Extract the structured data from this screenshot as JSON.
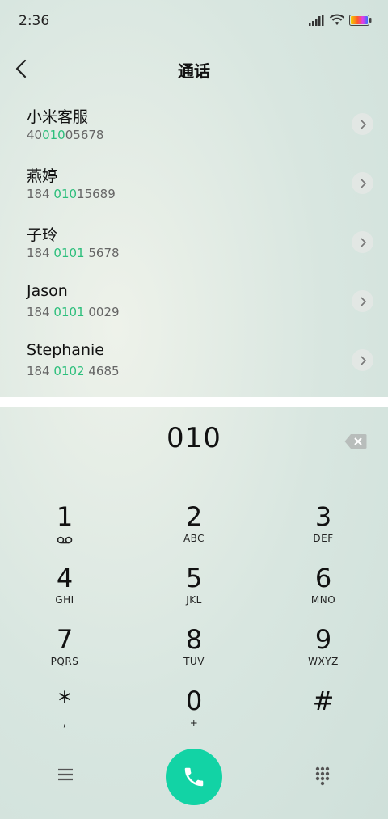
{
  "status_bar": {
    "time": "2:36",
    "icons": [
      "signal-icon",
      "wifi-icon",
      "battery-icon"
    ]
  },
  "header": {
    "title": "通话",
    "back_icon": "back-arrow-icon"
  },
  "contacts": [
    {
      "name": "小米客服",
      "number_pre": "40",
      "number_hl": "010",
      "number_post": "05678"
    },
    {
      "name": "燕婷",
      "number_pre": "184 ",
      "number_hl": "010",
      "number_post": "15689"
    },
    {
      "name": "子玲",
      "number_pre": "184 ",
      "number_hl": "0101",
      "number_post": " 5678"
    },
    {
      "name": "Jason",
      "number_pre": "184 ",
      "number_hl": "0101",
      "number_post": " 0029"
    },
    {
      "name": "Stephanie",
      "number_pre": "184 ",
      "number_hl": "0102",
      "number_post": " 4685"
    }
  ],
  "dialer": {
    "input_value": "010",
    "keys": [
      {
        "digit": "1",
        "letters": ""
      },
      {
        "digit": "2",
        "letters": "ABC"
      },
      {
        "digit": "3",
        "letters": "DEF"
      },
      {
        "digit": "4",
        "letters": "GHI"
      },
      {
        "digit": "5",
        "letters": "JKL"
      },
      {
        "digit": "6",
        "letters": "MNO"
      },
      {
        "digit": "7",
        "letters": "PQRS"
      },
      {
        "digit": "8",
        "letters": "TUV"
      },
      {
        "digit": "9",
        "letters": "WXYZ"
      },
      {
        "digit": "*",
        "letters": ","
      },
      {
        "digit": "0",
        "letters": "+"
      },
      {
        "digit": "#",
        "letters": ""
      }
    ]
  },
  "colors": {
    "accent_green": "#2dbf7c",
    "call_button": "#12d3a5"
  }
}
